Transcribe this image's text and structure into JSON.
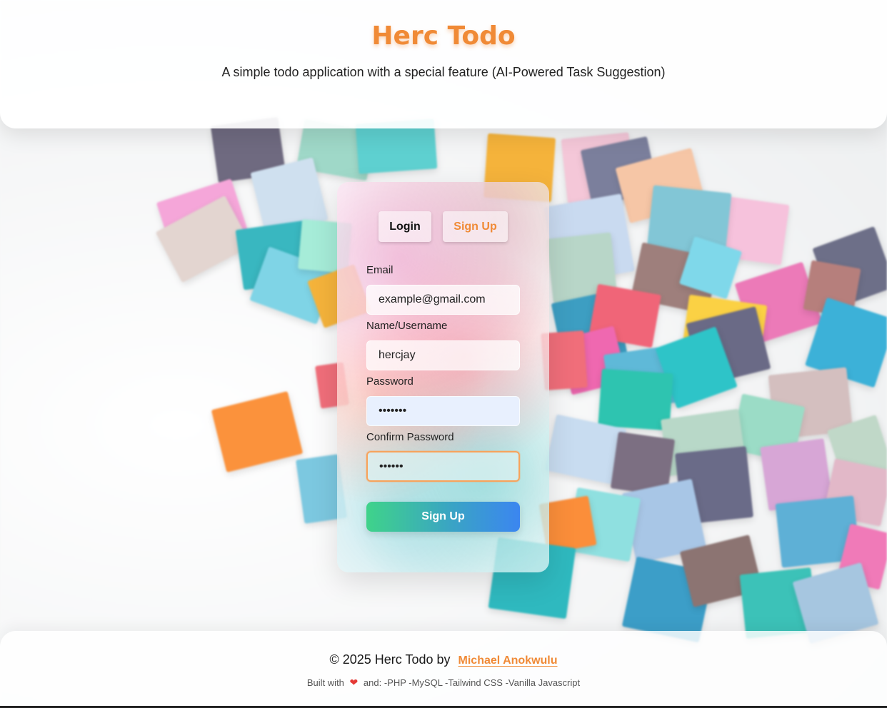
{
  "header": {
    "title": "Herc Todo",
    "subtitle": "A simple todo application with a special feature (AI-Powered Task Suggestion)"
  },
  "auth": {
    "tabs": [
      {
        "label": "Login",
        "active": false
      },
      {
        "label": "Sign Up",
        "active": true
      }
    ],
    "fields": {
      "email": {
        "label": "Email",
        "value": "example@gmail.com"
      },
      "username": {
        "label": "Name/Username",
        "value": "hercjay"
      },
      "password": {
        "label": "Password",
        "value": "•••••••"
      },
      "confirm": {
        "label": "Confirm Password",
        "value": "••••••"
      }
    },
    "submit_label": "Sign Up"
  },
  "footer": {
    "copyright": "© 2025 Herc Todo by",
    "author": "Michael Anokwulu",
    "built_prefix": "Built with",
    "built_suffix": "and: -PHP -MySQL -Tailwind CSS -Vanilla Javascript"
  },
  "colors": {
    "brand": "#f08a36",
    "gradient_start": "#3fd38a",
    "gradient_end": "#3b86f0",
    "focus_border": "#f7a35c"
  },
  "icons": {
    "heart": "heart-icon"
  }
}
